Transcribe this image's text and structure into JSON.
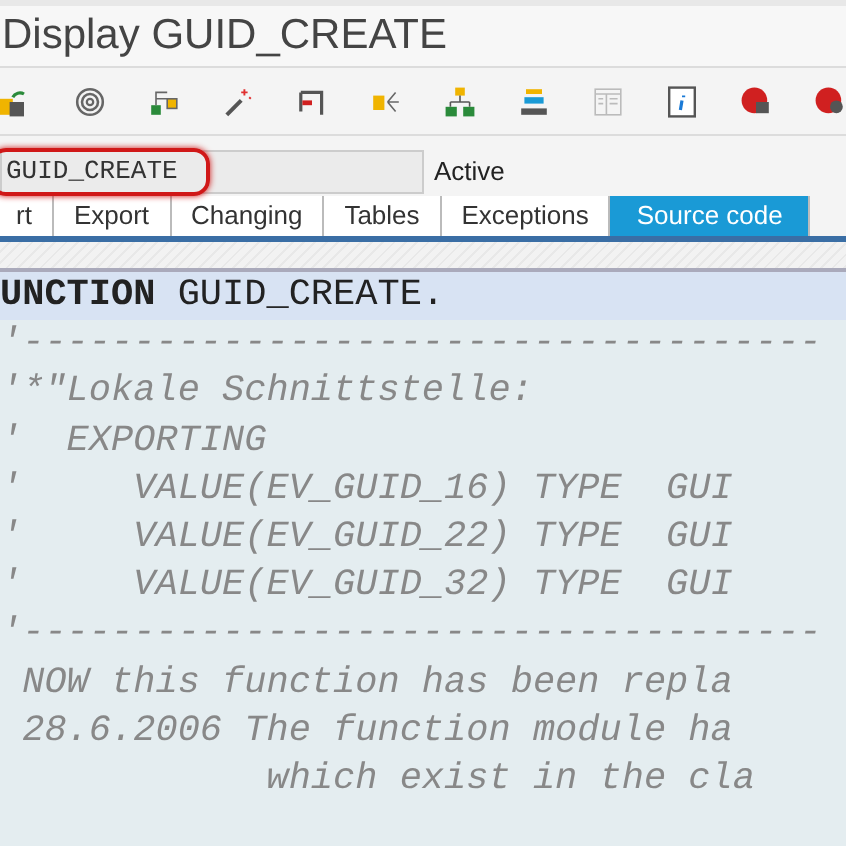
{
  "window": {
    "title": "Display GUID_CREATE"
  },
  "function_field": {
    "value": "GUID_CREATE",
    "highlighted": true
  },
  "status": "Active",
  "tabs": [
    {
      "label": "rt",
      "selected": false
    },
    {
      "label": "Export",
      "selected": false
    },
    {
      "label": "Changing",
      "selected": false
    },
    {
      "label": "Tables",
      "selected": false
    },
    {
      "label": "Exceptions",
      "selected": false
    },
    {
      "label": "Source code",
      "selected": true
    }
  ],
  "code_lines": [
    {
      "text": "**UNCTION** GUID_CREATE.",
      "kind": "statement",
      "current": true
    },
    {
      "text": "'------------------------------------",
      "kind": "comment",
      "current": false
    },
    {
      "text": "'*\"Lokale Schnittstelle:",
      "kind": "comment",
      "current": false
    },
    {
      "text": "'  EXPORTING",
      "kind": "comment",
      "current": false
    },
    {
      "text": "'     VALUE(EV_GUID_16) TYPE  GUI",
      "kind": "comment",
      "current": false
    },
    {
      "text": "'     VALUE(EV_GUID_22) TYPE  GUI",
      "kind": "comment",
      "current": false
    },
    {
      "text": "'     VALUE(EV_GUID_32) TYPE  GUI",
      "kind": "comment",
      "current": false
    },
    {
      "text": "'------------------------------------",
      "kind": "comment",
      "current": false
    },
    {
      "text": " NOW this function has been repla",
      "kind": "comment",
      "current": false
    },
    {
      "text": " 28.6.2006 The function module ha",
      "kind": "comment",
      "current": false
    },
    {
      "text": "            which exist in the cla",
      "kind": "comment",
      "current": false
    }
  ]
}
